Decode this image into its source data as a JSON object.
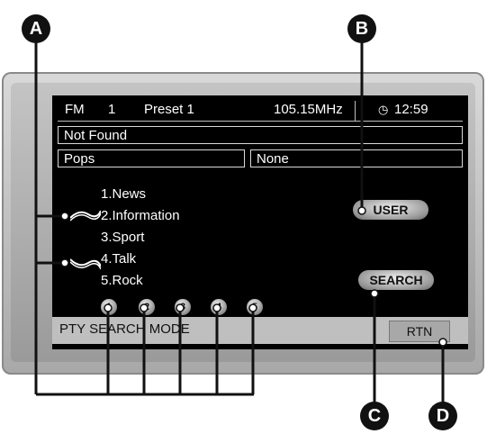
{
  "header": {
    "band": "FM",
    "channel": "1",
    "preset": "Preset 1",
    "frequency": "105.15MHz",
    "time": "12:59"
  },
  "message": "Not Found",
  "pty_bar": {
    "left": "Pops",
    "right": "None"
  },
  "pty_list": [
    "1.News",
    "2.Information",
    "3.Sport",
    "4.Talk",
    "5.Rock"
  ],
  "buttons": {
    "user": "USER",
    "search": "SEARCH",
    "rtn": "RTN"
  },
  "preset_buttons": [
    "1",
    "2",
    "3",
    "4",
    "5"
  ],
  "status": "PTY SEARCH MODE",
  "callouts": {
    "a": "A",
    "b": "B",
    "c": "C",
    "d": "D"
  }
}
